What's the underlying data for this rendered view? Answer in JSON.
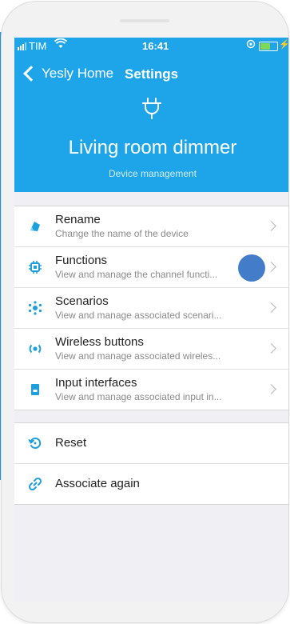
{
  "status_bar": {
    "carrier": "TIM",
    "time": "16:41"
  },
  "nav": {
    "back_label": "Yesly Home",
    "title": "Settings"
  },
  "device": {
    "name": "Living room dimmer",
    "subtitle": "Device management"
  },
  "menu": [
    {
      "icon": "tag-icon",
      "title": "Rename",
      "subtitle": "Change the name of the device"
    },
    {
      "icon": "chip-icon",
      "title": "Functions",
      "subtitle": "View and manage the channel functi..."
    },
    {
      "icon": "scenario-icon",
      "title": "Scenarios",
      "subtitle": "View and manage associated scenari..."
    },
    {
      "icon": "wireless-icon",
      "title": "Wireless buttons",
      "subtitle": "View and manage associated wireles..."
    },
    {
      "icon": "input-icon",
      "title": "Input interfaces",
      "subtitle": "View and manage associated input in..."
    }
  ],
  "actions": [
    {
      "icon": "reset-icon",
      "label": "Reset"
    },
    {
      "icon": "link-icon",
      "label": "Associate again"
    }
  ],
  "colors": {
    "header": "#1ea5e9",
    "icon_accent": "#1c9fdf",
    "background": "#efeff4"
  }
}
